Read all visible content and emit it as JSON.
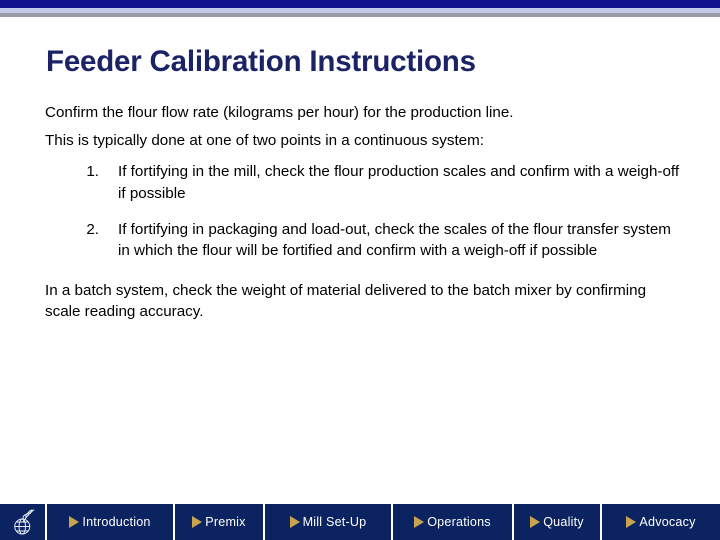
{
  "slide": {
    "title": "Feeder Calibration Instructions",
    "intro": [
      "Confirm the flour flow rate (kilograms per hour) for the production line.",
      "This is typically done at one of two points in a continuous system:"
    ],
    "steps": [
      {
        "number": "1.",
        "text": "If fortifying in the mill, check the flour production scales and confirm with a weigh-off if possible"
      },
      {
        "number": "2.",
        "text": "If fortifying in packaging and load-out, check the scales of the flour transfer system in which the flour will be fortified and confirm with a weigh-off if possible"
      }
    ],
    "closing": "In a batch system, check the weight of material delivered to the batch mixer by confirming scale reading accuracy."
  },
  "footer": {
    "logo_name": "globe-wheat-logo",
    "buttons": [
      {
        "label": "Introduction"
      },
      {
        "label": "Premix"
      },
      {
        "label": "Mill Set-Up"
      },
      {
        "label": "Operations"
      },
      {
        "label": "Quality"
      },
      {
        "label": "Advocacy"
      }
    ]
  },
  "colors": {
    "band_navy": "#12128c",
    "band_lavender": "#c3cbe8",
    "band_gray": "#9a9aa8",
    "title_navy": "#1b2266",
    "footer_navy": "#0b2361",
    "arrow_gold": "#c9a44c"
  }
}
